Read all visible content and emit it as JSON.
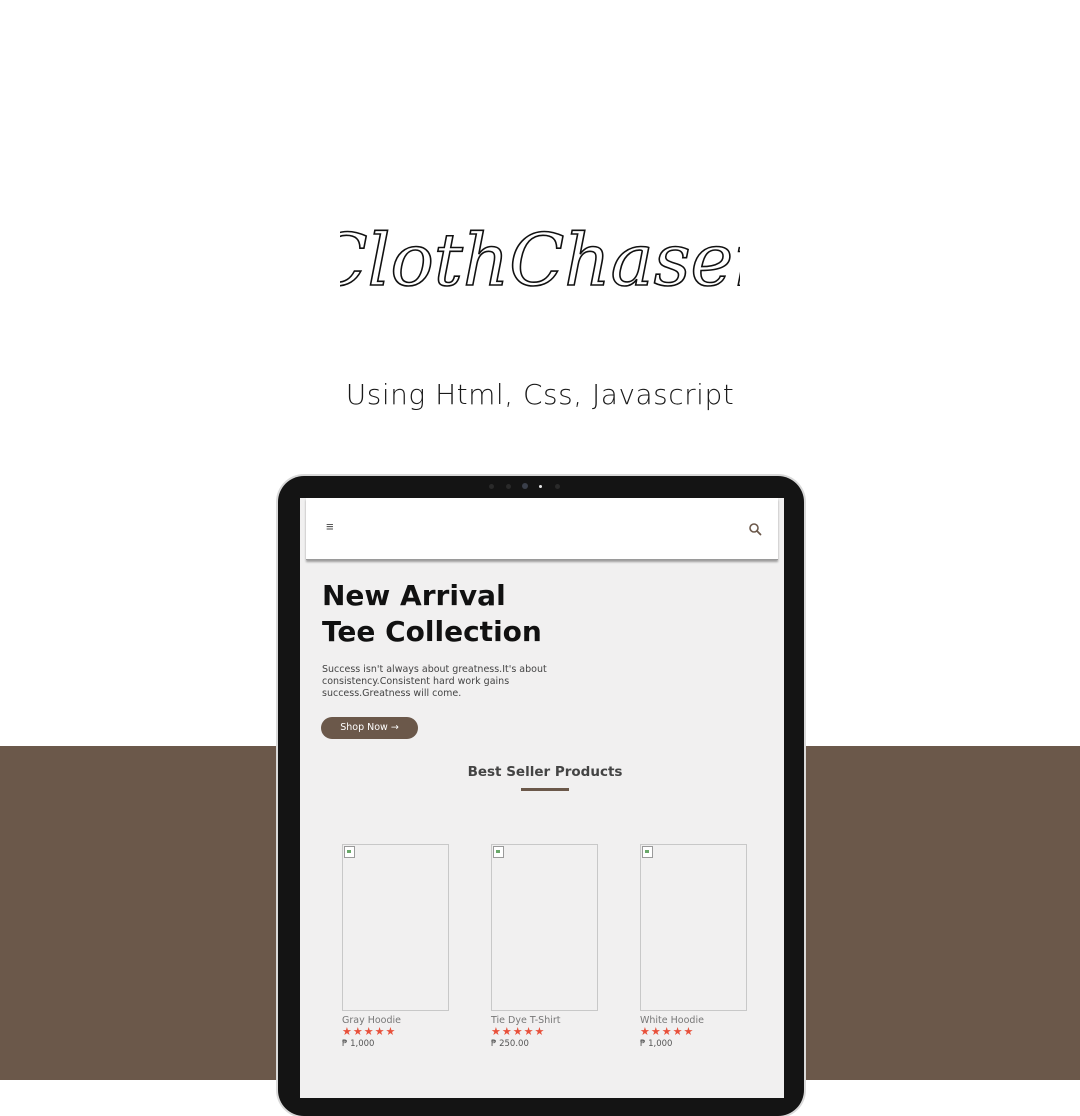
{
  "brand": {
    "logo_text": "ClothChaser",
    "subtitle": "Using Html, Css, Javascript"
  },
  "colors": {
    "accent": "#6b584a",
    "star": "#e8503a",
    "screen_bg": "#f1f0f0"
  },
  "navbar": {
    "menu_icon": "hamburger-icon",
    "menu_glyph": "≡",
    "search_icon": "search-icon"
  },
  "hero": {
    "title_line1": "New Arrival",
    "title_line2": "Tee Collection",
    "description": "Success isn't always about greatness.It's about consistency.Consistent hard work gains success.Greatness will come.",
    "button_label": "Shop Now →"
  },
  "best_sellers": {
    "title": "Best Seller Products",
    "products": [
      {
        "name": "Gray Hoodie",
        "rating": 5,
        "stars": "★★★★★",
        "price": "₱ 1,000"
      },
      {
        "name": "Tie Dye T-Shirt",
        "rating": 5,
        "stars": "★★★★★",
        "price": "₱ 250.00"
      },
      {
        "name": "White Hoodie",
        "rating": 5,
        "stars": "★★★★★",
        "price": "₱ 1,000"
      }
    ]
  }
}
